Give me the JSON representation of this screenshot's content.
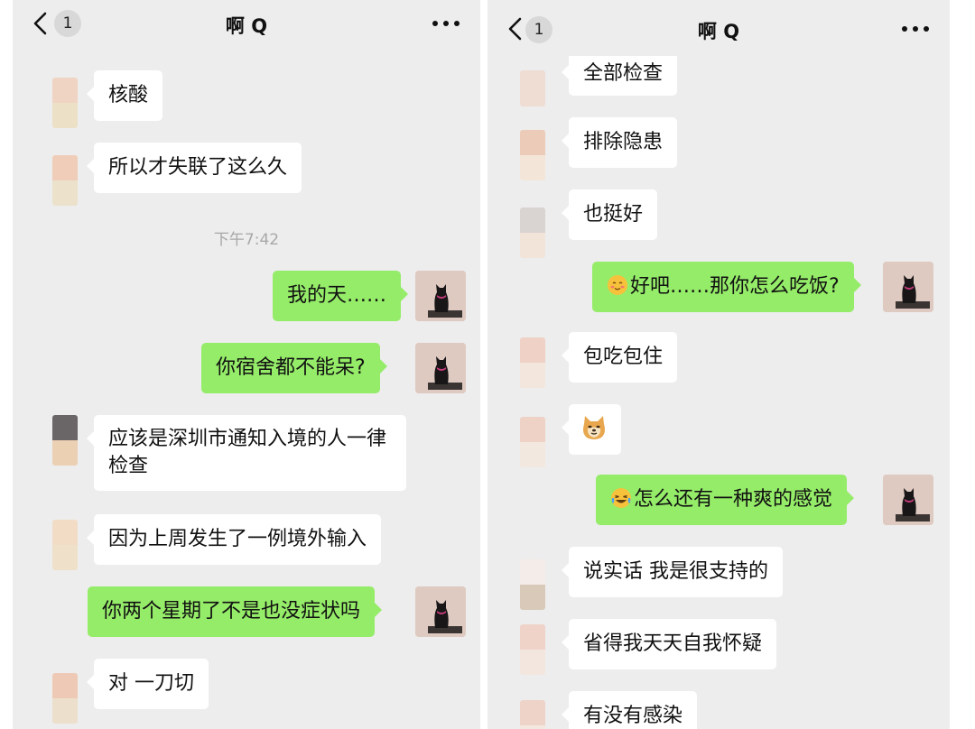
{
  "left": {
    "header": {
      "unread": "1",
      "title": "啊 Q"
    },
    "timestamp": "下午7:42",
    "messages": [
      {
        "text": "核酸"
      },
      {
        "text": "所以才失联了这么久"
      },
      {
        "text": "我的天……"
      },
      {
        "text": "你宿舍都不能呆?"
      },
      {
        "text": "应该是深圳市通知入境的人一律检查"
      },
      {
        "text": "因为上周发生了一例境外输入"
      },
      {
        "text": "你两个星期了不是也没症状吗"
      },
      {
        "text": "对 一刀切"
      }
    ]
  },
  "right": {
    "header": {
      "unread": "1",
      "title": "啊 Q"
    },
    "messages": [
      {
        "text": "全部检查"
      },
      {
        "text": "排除隐患"
      },
      {
        "text": "也挺好"
      },
      {
        "text": "好吧……那你怎么吃饭?",
        "emoji": "blush-face-icon"
      },
      {
        "text": "包吃包住"
      },
      {
        "emoji": "doge-icon"
      },
      {
        "text": "怎么还有一种爽的感觉",
        "emoji": "tears-of-joy-icon"
      },
      {
        "text": "说实话 我是很支持的"
      },
      {
        "text": "省得我天天自我怀疑"
      },
      {
        "text": "有没有感染"
      }
    ]
  },
  "colors": {
    "background": "#ededed",
    "bubble_in": "#ffffff",
    "bubble_out": "#95ec69",
    "timestamp": "#a8a8a8"
  }
}
